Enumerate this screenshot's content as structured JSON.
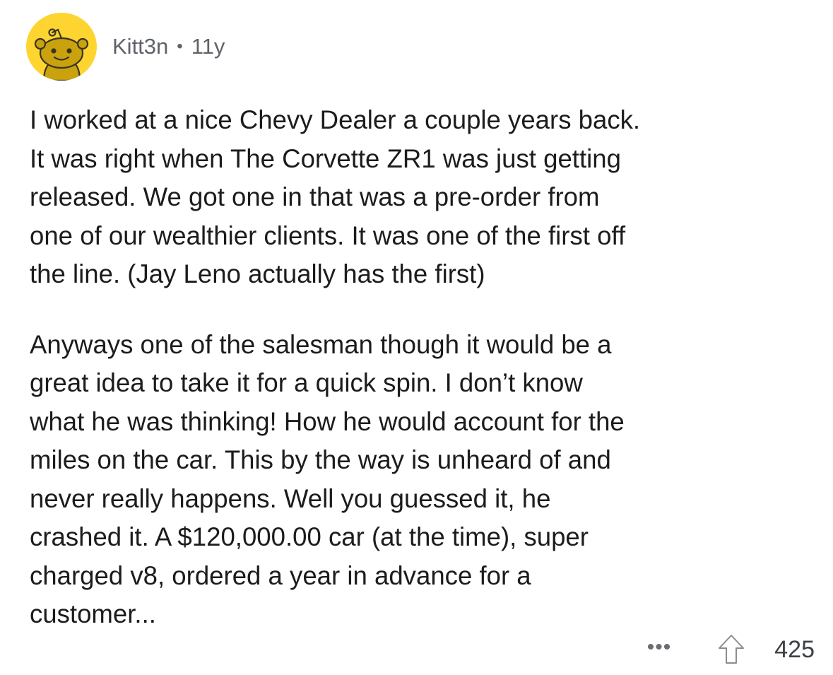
{
  "comment": {
    "author": "Kitt3n",
    "separator": "•",
    "age": "11y",
    "avatar_icon": "snoo-avatar-icon",
    "avatar_color": "#fed430",
    "paragraphs": [
      "I worked at a nice Chevy Dealer a couple years back.\nIt was right when The Corvette ZR1 was just getting\nreleased. We got one in that was a pre-order from\none of our wealthier clients. It was one of the first off\nthe line. (Jay Leno actually has the first)",
      "Anyways one of the salesman though it would be a\ngreat idea to take it for a quick spin. I don’t know\nwhat he was thinking! How he would account for the\nmiles on the car. This by the way is unheard of and\nnever really happens. Well you guessed it, he\ncrashed it. A $120,000.00 car (at the time), super\ncharged v8, ordered a year in advance for a\ncustomer..."
    ],
    "more_label": "•••",
    "more_icon": "more-options-icon",
    "upvote_icon": "upvote-arrow-icon",
    "score": "425"
  }
}
